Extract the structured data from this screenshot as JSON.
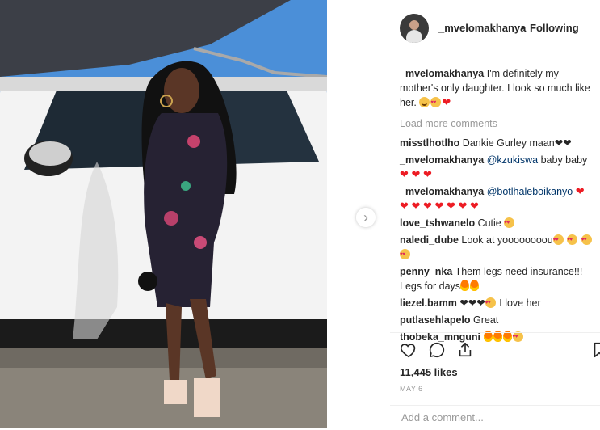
{
  "post": {
    "username": "_mvelomakhanya",
    "separator": "•",
    "follow_status": "Following"
  },
  "caption": {
    "username": "_mvelomakhanya",
    "text": "I'm definitely my mother's only daughter. I look so much like her."
  },
  "load_more_label": "Load more comments",
  "comments": [
    {
      "user": "misstlhotlho",
      "text": "Dankie Gurley maan❤❤"
    },
    {
      "user": "_mvelomakhanya",
      "mention": "@kzukiswa",
      "text": " baby baby"
    },
    {
      "user": "_mvelomakhanya",
      "mention": "@botlhaleboikanyo",
      "text": ""
    },
    {
      "user": "love_tshwanelo",
      "text": "Cutie"
    },
    {
      "user": "naledi_dube",
      "text": "Look at yoooooooou"
    },
    {
      "user": "penny_nka",
      "text": "Them legs need insurance!!! Legs for days"
    },
    {
      "user": "liezel.bamm",
      "text": "❤❤❤",
      "text2": " I love her"
    },
    {
      "user": "putlasehlapelo",
      "text": "Great"
    },
    {
      "user": "thobeka_mnguni",
      "text": ""
    }
  ],
  "likes_label": "11,445 likes",
  "date_label": "MAY 6",
  "add_comment_placeholder": "Add a comment...",
  "icons": {
    "like": "heart-outline-icon",
    "comment": "speech-bubble-icon",
    "share": "share-icon",
    "save": "bookmark-icon",
    "next": "chevron-right-icon"
  }
}
